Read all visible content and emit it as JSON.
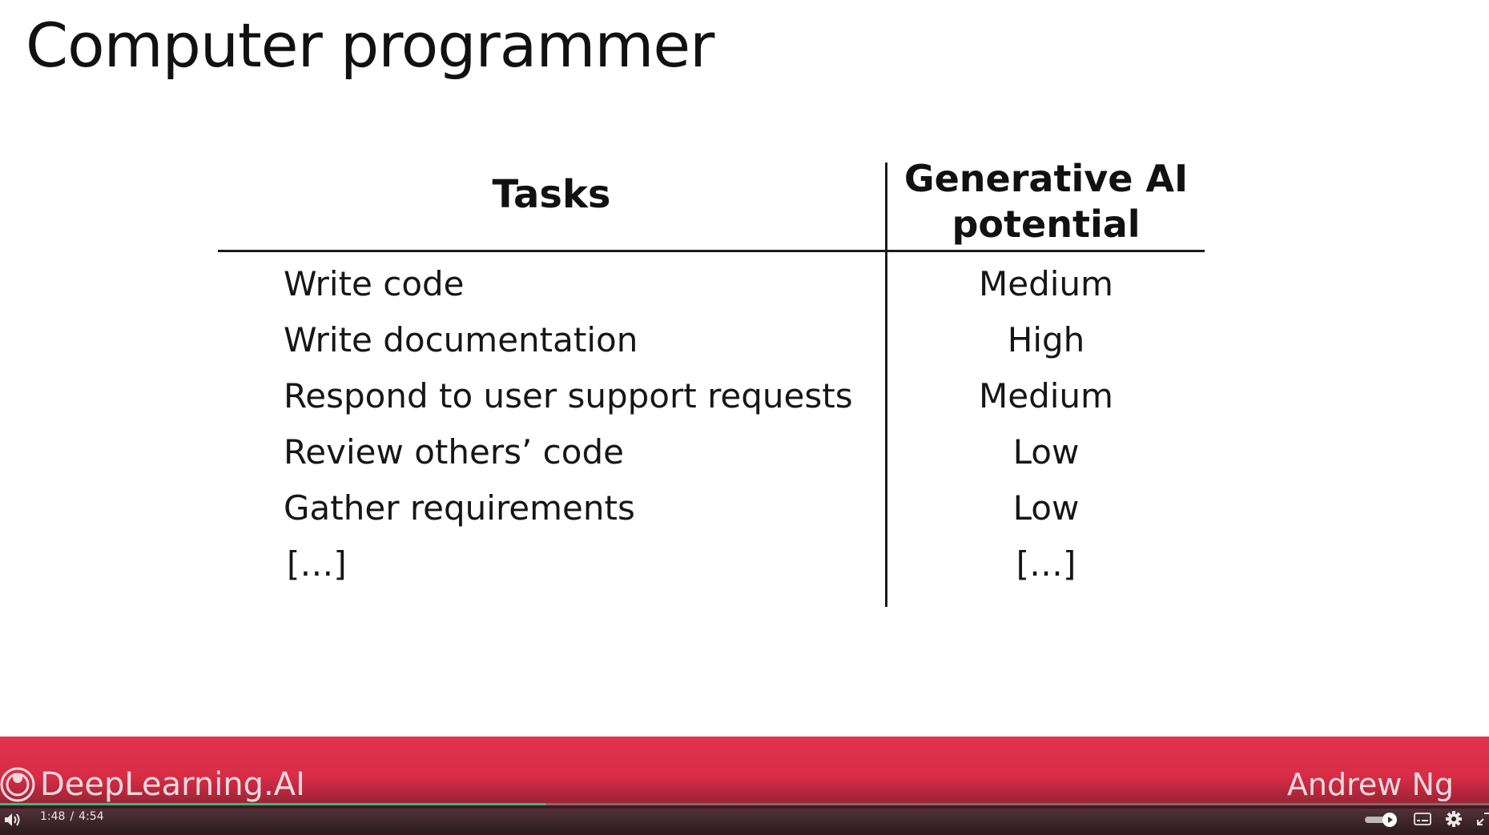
{
  "slide": {
    "title": "Computer programmer",
    "table": {
      "header_tasks": "Tasks",
      "header_potential": "Generative AI\npotential",
      "rows": [
        {
          "task": "Write code",
          "potential": "Medium"
        },
        {
          "task": "Write documentation",
          "potential": "High"
        },
        {
          "task": "Respond to user support requests",
          "potential": "Medium"
        },
        {
          "task": "Review others’ code",
          "potential": "Low"
        },
        {
          "task": "Gather requirements",
          "potential": "Low"
        },
        {
          "task": "[…]",
          "potential": "[…]"
        }
      ]
    }
  },
  "banner": {
    "brand": "DeepLearning.AI",
    "presenter": "Andrew Ng",
    "color": "#d92c46"
  },
  "player": {
    "current_time": "1:48",
    "duration": "4:54",
    "progress_fraction": 0.367,
    "progress_color": "#2fbf71",
    "icons": [
      "volume-icon",
      "autoplay-toggle",
      "captions-icon",
      "settings-gear-icon",
      "fullscreen-icon"
    ]
  }
}
